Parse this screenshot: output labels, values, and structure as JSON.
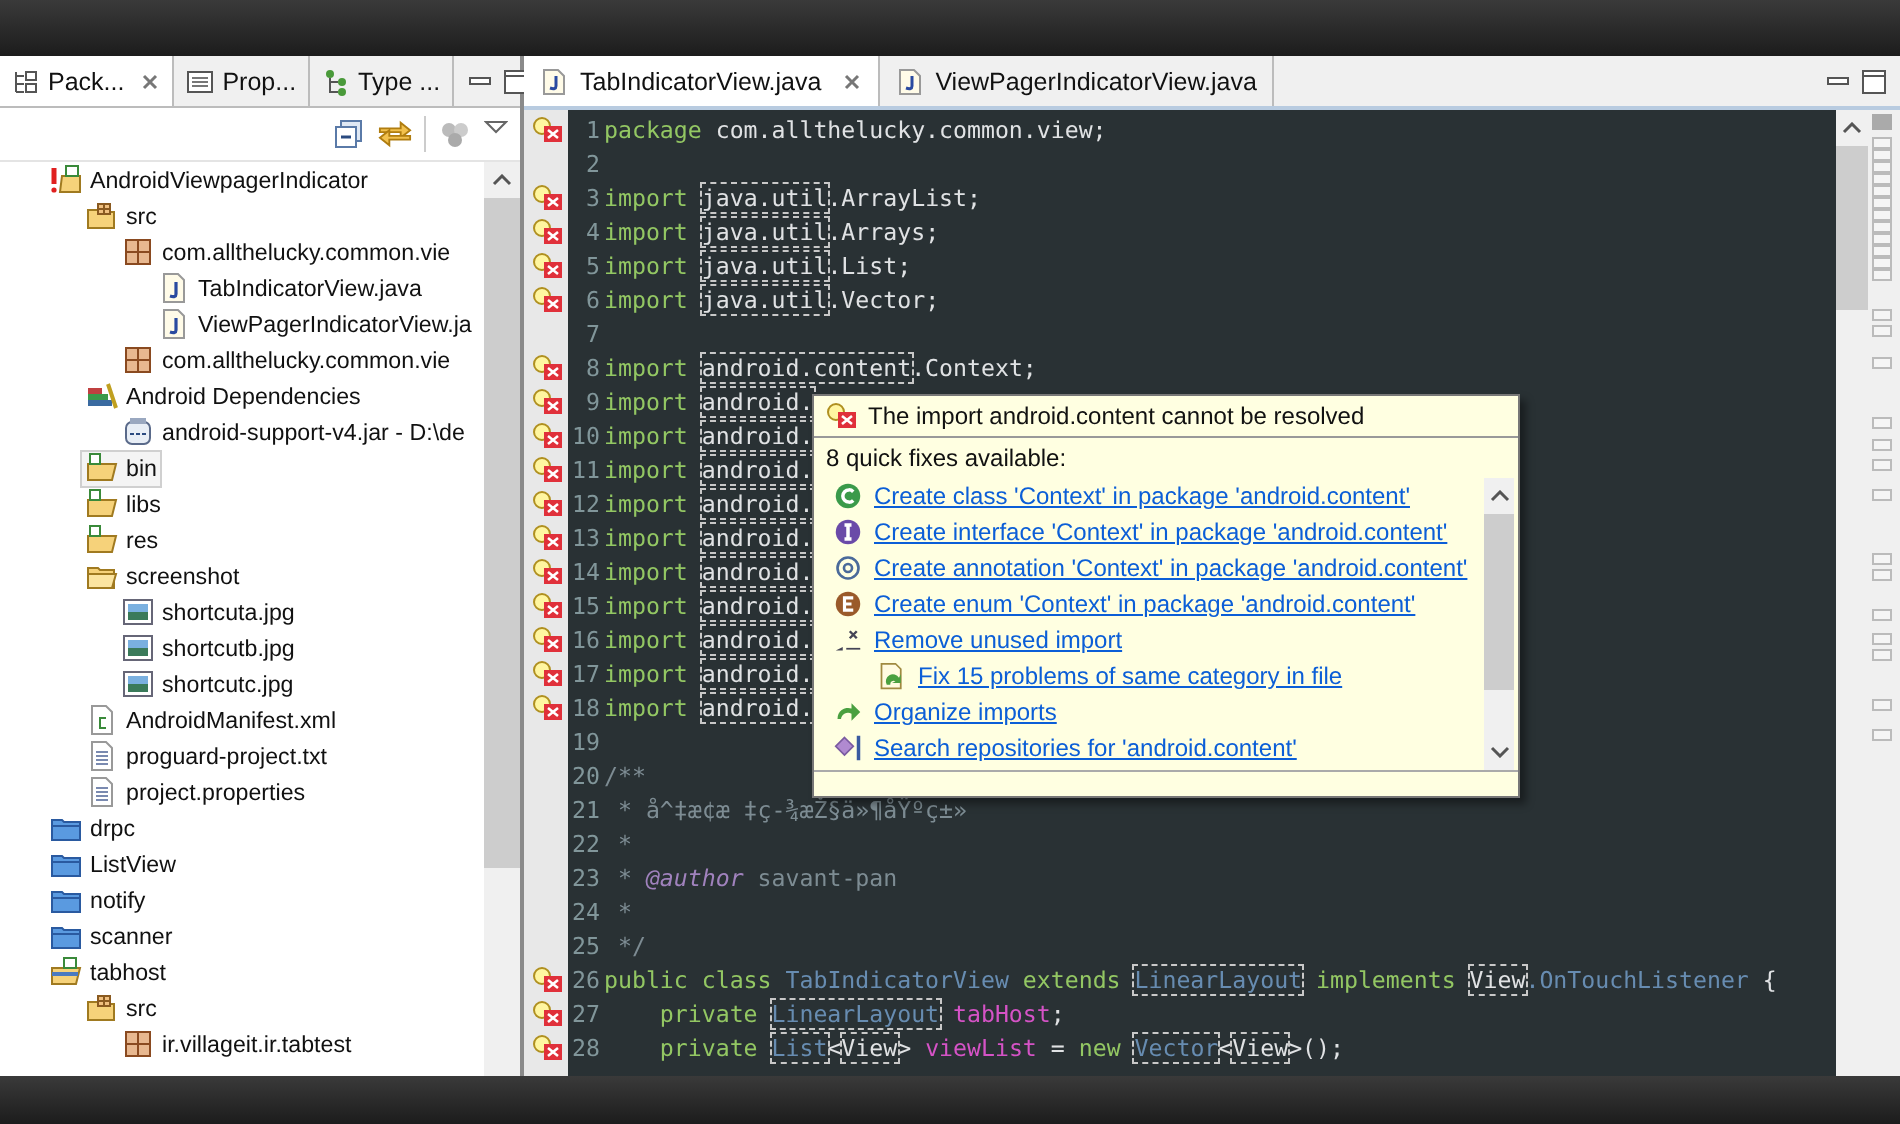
{
  "explorer": {
    "tabs": [
      {
        "label": "Pack...",
        "selected": true,
        "closable": true
      },
      {
        "label": "Prop...",
        "selected": false,
        "closable": false
      },
      {
        "label": "Type ...",
        "selected": false,
        "closable": false
      }
    ],
    "tree": [
      {
        "label": "AndroidViewpagerIndicator",
        "kind": "project-error",
        "selected": false,
        "children": [
          {
            "label": "src",
            "kind": "src-folder",
            "selected": false,
            "children": [
              {
                "label": "com.allthelucky.common.vie",
                "kind": "package",
                "selected": false,
                "children": [
                  {
                    "label": "TabIndicatorView.java",
                    "kind": "java",
                    "selected": false
                  },
                  {
                    "label": "ViewPagerIndicatorView.ja",
                    "kind": "java",
                    "selected": false
                  }
                ]
              },
              {
                "label": "com.allthelucky.common.vie",
                "kind": "package",
                "selected": false
              }
            ]
          },
          {
            "label": "Android Dependencies",
            "kind": "library",
            "selected": false,
            "children": [
              {
                "label": "android-support-v4.jar - D:\\de",
                "kind": "jar",
                "selected": false
              }
            ]
          },
          {
            "label": "bin",
            "kind": "folder",
            "selected": true
          },
          {
            "label": "libs",
            "kind": "folder",
            "selected": false
          },
          {
            "label": "res",
            "kind": "folder",
            "selected": false
          },
          {
            "label": "screenshot",
            "kind": "plain-folder",
            "selected": false,
            "children": [
              {
                "label": "shortcuta.jpg",
                "kind": "image",
                "selected": false
              },
              {
                "label": "shortcutb.jpg",
                "kind": "image",
                "selected": false
              },
              {
                "label": "shortcutc.jpg",
                "kind": "image",
                "selected": false
              }
            ]
          },
          {
            "label": "AndroidManifest.xml",
            "kind": "xml",
            "selected": false
          },
          {
            "label": "proguard-project.txt",
            "kind": "file",
            "selected": false
          },
          {
            "label": "project.properties",
            "kind": "file",
            "selected": false
          }
        ]
      },
      {
        "label": "drpc",
        "kind": "closed-project",
        "selected": false
      },
      {
        "label": "ListView",
        "kind": "closed-project",
        "selected": false
      },
      {
        "label": "notify",
        "kind": "closed-project",
        "selected": false
      },
      {
        "label": "scanner",
        "kind": "closed-project",
        "selected": false
      },
      {
        "label": "tabhost",
        "kind": "project",
        "selected": false,
        "children": [
          {
            "label": "src",
            "kind": "src-folder",
            "selected": false,
            "children": [
              {
                "label": "ir.villageit.ir.tabtest",
                "kind": "package",
                "selected": false
              }
            ]
          }
        ]
      }
    ]
  },
  "editor": {
    "tabs": [
      {
        "label": "TabIndicatorView.java",
        "selected": true,
        "closable": true
      },
      {
        "label": "ViewPagerIndicatorView.java",
        "selected": false,
        "closable": false
      }
    ],
    "lines": [
      {
        "num": "1",
        "error": true,
        "tokens": [
          {
            "text": "package ",
            "kind": "keyword"
          },
          {
            "text": "com.allthelucky.common.view;",
            "kind": "plain"
          }
        ]
      },
      {
        "num": "2",
        "error": false
      },
      {
        "num": "3",
        "error": true,
        "tokens": [
          {
            "text": "import ",
            "kind": "keyword"
          },
          {
            "text": "java.util",
            "kind": "missing"
          },
          {
            "text": ".ArrayList;",
            "kind": "plain"
          }
        ]
      },
      {
        "num": "4",
        "error": true,
        "tokens": [
          {
            "text": "import ",
            "kind": "keyword"
          },
          {
            "text": "java.util",
            "kind": "missing"
          },
          {
            "text": ".Arrays;",
            "kind": "plain"
          }
        ]
      },
      {
        "num": "5",
        "error": true,
        "tokens": [
          {
            "text": "import ",
            "kind": "keyword"
          },
          {
            "text": "java.util",
            "kind": "missing"
          },
          {
            "text": ".List;",
            "kind": "plain"
          }
        ]
      },
      {
        "num": "6",
        "error": true,
        "tokens": [
          {
            "text": "import ",
            "kind": "keyword"
          },
          {
            "text": "java.util",
            "kind": "missing"
          },
          {
            "text": ".Vector;",
            "kind": "plain"
          }
        ]
      },
      {
        "num": "7",
        "error": false
      },
      {
        "num": "8",
        "error": true,
        "tokens": [
          {
            "text": "import ",
            "kind": "keyword"
          },
          {
            "text": "android.content",
            "kind": "missing"
          },
          {
            "text": ".Context;",
            "kind": "plain"
          }
        ]
      },
      {
        "num": "9",
        "error": true,
        "tokens": [
          {
            "text": "import ",
            "kind": "keyword"
          },
          {
            "text": "android.",
            "kind": "missing"
          }
        ]
      },
      {
        "num": "10",
        "error": true,
        "tokens": [
          {
            "text": "import ",
            "kind": "keyword"
          },
          {
            "text": "android.",
            "kind": "missing"
          }
        ]
      },
      {
        "num": "11",
        "error": true,
        "tokens": [
          {
            "text": "import ",
            "kind": "keyword"
          },
          {
            "text": "android.",
            "kind": "missing"
          }
        ]
      },
      {
        "num": "12",
        "error": true,
        "tokens": [
          {
            "text": "import ",
            "kind": "keyword"
          },
          {
            "text": "android.",
            "kind": "missing"
          }
        ]
      },
      {
        "num": "13",
        "error": true,
        "tokens": [
          {
            "text": "import ",
            "kind": "keyword"
          },
          {
            "text": "android.",
            "kind": "missing"
          }
        ]
      },
      {
        "num": "14",
        "error": true,
        "tokens": [
          {
            "text": "import ",
            "kind": "keyword"
          },
          {
            "text": "android.",
            "kind": "missing"
          }
        ]
      },
      {
        "num": "15",
        "error": true,
        "tokens": [
          {
            "text": "import ",
            "kind": "keyword"
          },
          {
            "text": "android.",
            "kind": "missing"
          }
        ]
      },
      {
        "num": "16",
        "error": true,
        "tokens": [
          {
            "text": "import ",
            "kind": "keyword"
          },
          {
            "text": "android.",
            "kind": "missing"
          }
        ]
      },
      {
        "num": "17",
        "error": true,
        "tokens": [
          {
            "text": "import ",
            "kind": "keyword"
          },
          {
            "text": "android.",
            "kind": "missing"
          }
        ]
      },
      {
        "num": "18",
        "error": true,
        "tokens": [
          {
            "text": "import ",
            "kind": "keyword"
          },
          {
            "text": "android.",
            "kind": "missing"
          }
        ]
      },
      {
        "num": "19",
        "error": false
      },
      {
        "num": "20",
        "error": false,
        "tokens": [
          {
            "text": "/**",
            "kind": "comment"
          }
        ]
      },
      {
        "num": "21",
        "error": false,
        "tokens": [
          {
            "text": " * å^‡æ¢æ ‡ç-¾æŽ§ä»¶åŸºç±»",
            "kind": "comment"
          }
        ]
      },
      {
        "num": "22",
        "error": false,
        "tokens": [
          {
            "text": " *",
            "kind": "comment"
          }
        ]
      },
      {
        "num": "23",
        "error": false,
        "tokens": [
          {
            "text": " * ",
            "kind": "comment"
          },
          {
            "text": "@author",
            "kind": "doctag"
          },
          {
            "text": " savant-pan",
            "kind": "comment"
          }
        ]
      },
      {
        "num": "24",
        "error": false,
        "tokens": [
          {
            "text": " *",
            "kind": "comment"
          }
        ]
      },
      {
        "num": "25",
        "error": false,
        "tokens": [
          {
            "text": " */",
            "kind": "comment"
          }
        ]
      },
      {
        "num": "26",
        "error": true,
        "tokens": [
          {
            "text": "public class ",
            "kind": "keyword"
          },
          {
            "text": "TabIndicatorView ",
            "kind": "type"
          },
          {
            "text": "extends ",
            "kind": "keyword"
          },
          {
            "text": "LinearLayout",
            "kind": "missing-type"
          },
          {
            "text": " implements ",
            "kind": "keyword"
          },
          {
            "text": "View",
            "kind": "missing"
          },
          {
            "text": ".OnTouchListener",
            "kind": "type"
          },
          {
            "text": " {",
            "kind": "plain"
          }
        ]
      },
      {
        "num": "27",
        "error": true,
        "tokens": [
          {
            "text": "    private ",
            "kind": "keyword"
          },
          {
            "text": "LinearLayout",
            "kind": "missing-type"
          },
          {
            "text": " tabHost",
            "kind": "field"
          },
          {
            "text": ";",
            "kind": "plain"
          }
        ]
      },
      {
        "num": "28",
        "error": true,
        "tokens": [
          {
            "text": "    private ",
            "kind": "keyword"
          },
          {
            "text": "List",
            "kind": "missing-type"
          },
          {
            "text": "<",
            "kind": "plain"
          },
          {
            "text": "View",
            "kind": "missing"
          },
          {
            "text": "> ",
            "kind": "plain"
          },
          {
            "text": "viewList",
            "kind": "field"
          },
          {
            "text": " = ",
            "kind": "plain"
          },
          {
            "text": "new ",
            "kind": "keyword"
          },
          {
            "text": "Vector",
            "kind": "missing-type"
          },
          {
            "text": "<",
            "kind": "plain"
          },
          {
            "text": "View",
            "kind": "missing"
          },
          {
            "text": ">();",
            "kind": "plain"
          }
        ]
      }
    ],
    "quick_fix": {
      "problem": "The import android.content cannot be resolved",
      "summary": "8 quick fixes available:",
      "fixes": [
        {
          "label": "Create class 'Context' in package 'android.content'",
          "kind": "class"
        },
        {
          "label": "Create interface 'Context' in package 'android.content'",
          "kind": "interface"
        },
        {
          "label": "Create annotation 'Context' in package 'android.content'",
          "kind": "annotation"
        },
        {
          "label": "Create enum 'Context' in package 'android.content'",
          "kind": "enum"
        },
        {
          "label": "Remove unused import",
          "kind": "remove",
          "children": [
            {
              "label": "Fix 15 problems of same category in file",
              "kind": "fix"
            }
          ]
        },
        {
          "label": "Organize imports",
          "kind": "organize"
        },
        {
          "label": "Search repositories for 'android.content'",
          "kind": "search"
        }
      ]
    }
  }
}
